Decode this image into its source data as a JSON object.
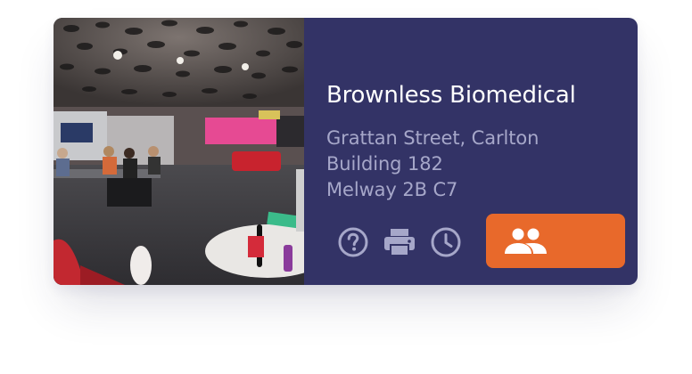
{
  "colors": {
    "panel": "#333366",
    "accent": "#e8692b",
    "title": "#ffffff",
    "address": "#a6a7c9",
    "icon": "#a6a7c9"
  },
  "photo": {
    "subject": "library study space interior"
  },
  "location": {
    "name": "Brownless Biomedical",
    "address_line1": "Grattan Street, Carlton",
    "address_line2": "Building 182",
    "address_line3": "Melway 2B C7"
  },
  "actions": {
    "help_icon": "help-circle-icon",
    "print_icon": "print-icon",
    "hours_icon": "clock-icon",
    "primary_icon": "people-icon"
  }
}
